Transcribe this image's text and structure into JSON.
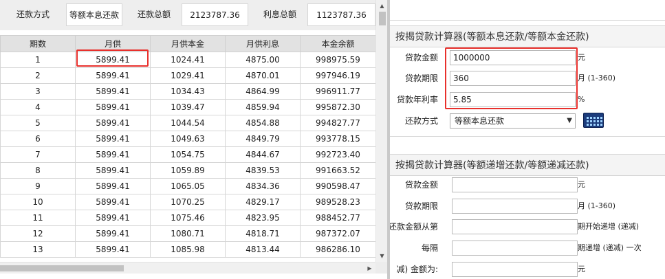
{
  "summary": {
    "method_label": "还款方式",
    "method_value": "等额本息还款",
    "total_label": "还款总额",
    "total_value": "2123787.36",
    "interest_label": "利息总额",
    "interest_value": "1123787.36"
  },
  "table": {
    "headers": [
      "期数",
      "月供",
      "月供本金",
      "月供利息",
      "本金余额"
    ],
    "rows": [
      [
        "1",
        "5899.41",
        "1024.41",
        "4875.00",
        "998975.59"
      ],
      [
        "2",
        "5899.41",
        "1029.41",
        "4870.01",
        "997946.19"
      ],
      [
        "3",
        "5899.41",
        "1034.43",
        "4864.99",
        "996911.77"
      ],
      [
        "4",
        "5899.41",
        "1039.47",
        "4859.94",
        "995872.30"
      ],
      [
        "5",
        "5899.41",
        "1044.54",
        "4854.88",
        "994827.77"
      ],
      [
        "6",
        "5899.41",
        "1049.63",
        "4849.79",
        "993778.15"
      ],
      [
        "7",
        "5899.41",
        "1054.75",
        "4844.67",
        "992723.40"
      ],
      [
        "8",
        "5899.41",
        "1059.89",
        "4839.53",
        "991663.52"
      ],
      [
        "9",
        "5899.41",
        "1065.05",
        "4834.36",
        "990598.47"
      ],
      [
        "10",
        "5899.41",
        "1070.25",
        "4829.17",
        "989528.23"
      ],
      [
        "11",
        "5899.41",
        "1075.46",
        "4823.95",
        "988452.77"
      ],
      [
        "12",
        "5899.41",
        "1080.71",
        "4818.71",
        "987372.07"
      ],
      [
        "13",
        "5899.41",
        "1085.98",
        "4813.44",
        "986286.10"
      ]
    ]
  },
  "calc1": {
    "title": "按揭贷款计算器(等额本息还款/等额本金还款)",
    "amount_label": "贷款金额",
    "amount_value": "1000000",
    "amount_unit": "元",
    "term_label": "贷款期限",
    "term_value": "360",
    "term_unit": "月 (1-360)",
    "rate_label": "贷款年利率",
    "rate_value": "5.85",
    "rate_unit": "%",
    "method_label": "还款方式",
    "method_value": "等额本息还款",
    "calc_icon": "calculator-icon"
  },
  "calc2": {
    "title": "按揭贷款计算器(等额递增还款/等额递减还款)",
    "amount_label": "贷款金额",
    "amount_unit": "元",
    "term_label": "贷款期限",
    "term_unit": "月 (1-360)",
    "start_label": "还款金额从第",
    "start_unit": "期开始递增 (递减)",
    "every_label": "每隔",
    "every_unit": "期递增 (递减) 一次",
    "change_label": "减) 金额为:",
    "change_unit": "元"
  },
  "colors": {
    "highlight": "#e8302c",
    "header_bg": "#e2e2e2",
    "calc_icon": "#1c3c7c"
  }
}
